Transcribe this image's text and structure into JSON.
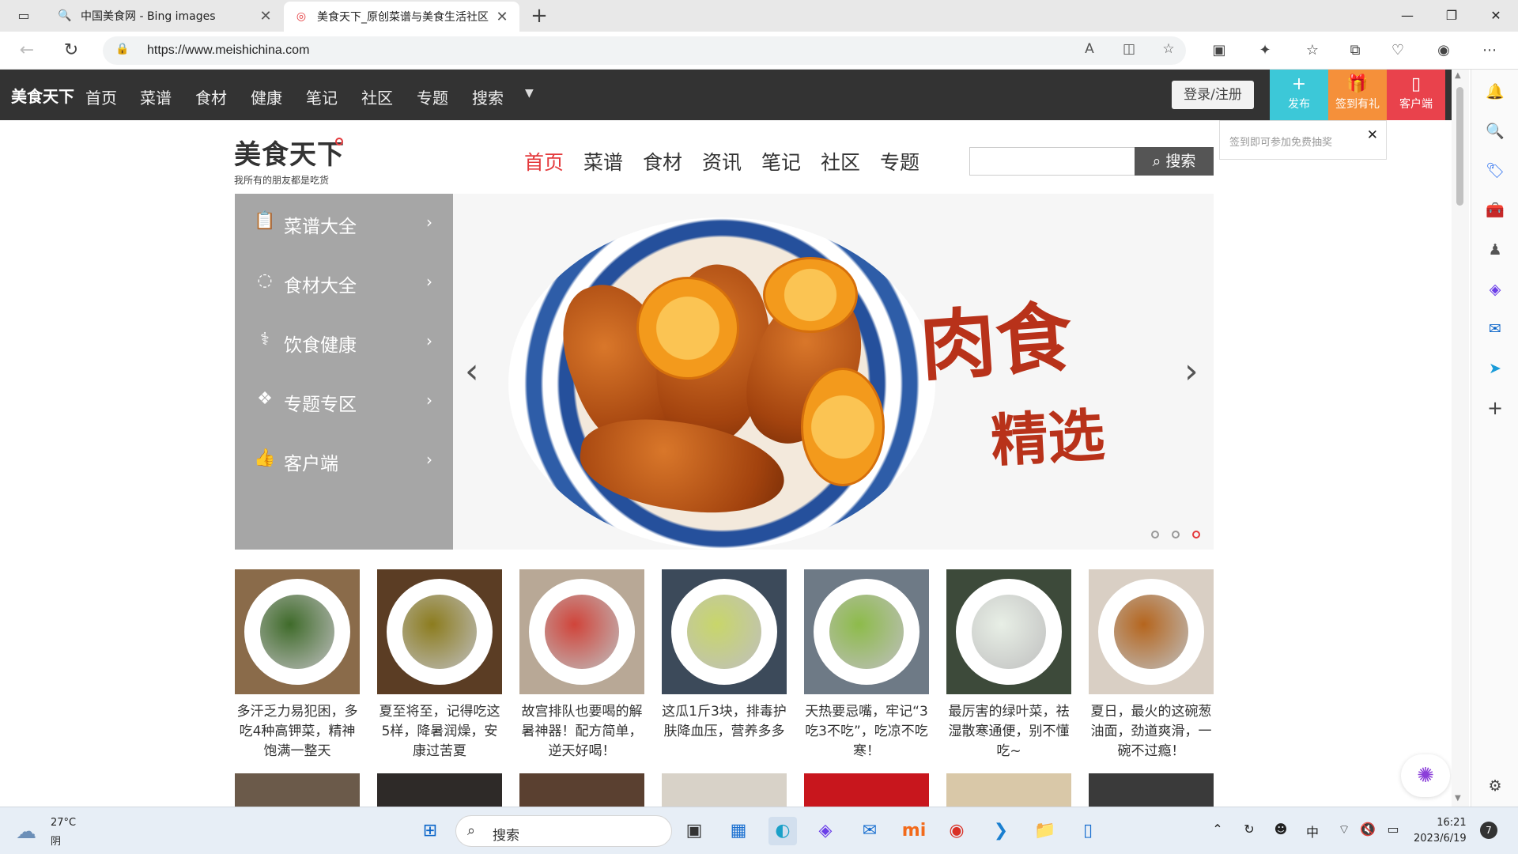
{
  "browser": {
    "tabs": [
      {
        "title": "中国美食网 - Bing images",
        "favicon": "bing-search-icon"
      },
      {
        "title": "美食天下_原创菜谱与美食生活社区",
        "favicon": "meishichina-icon"
      }
    ],
    "url": "https://www.meishichina.com"
  },
  "topbar": {
    "brand": "美食天下",
    "nav": [
      "首页",
      "菜谱",
      "食材",
      "健康",
      "笔记",
      "社区",
      "专题",
      "搜索"
    ],
    "login": "登录/注册",
    "actions": [
      {
        "label": "发布",
        "color": "#3cc8d8"
      },
      {
        "label": "签到有礼",
        "color": "#f5903a"
      },
      {
        "label": "客户端",
        "color": "#e9424c"
      }
    ],
    "signin_tip": "签到即可参加免费抽奖"
  },
  "header": {
    "logo": "美食天下",
    "slogan": "我所有的朋友都是吃货",
    "nav": [
      "首页",
      "菜谱",
      "食材",
      "资讯",
      "笔记",
      "社区",
      "专题"
    ],
    "search_button": "搜索"
  },
  "menu": [
    {
      "label": "菜谱大全",
      "icon": "clipboard-icon"
    },
    {
      "label": "食材大全",
      "icon": "tomato-icon"
    },
    {
      "label": "饮食健康",
      "icon": "pill-icon"
    },
    {
      "label": "专题专区",
      "icon": "diamond-grid-icon"
    },
    {
      "label": "客户端",
      "icon": "thumbs-up-icon"
    }
  ],
  "banner": {
    "title_line1": "肉食",
    "title_line2": "精选"
  },
  "recipes": [
    {
      "caption": "多汗乏力易犯困，多吃4种高钾菜，精神饱满一整天",
      "bg": "#8a6b4a",
      "food": "#3f6b2a"
    },
    {
      "caption": "夏至将至，记得吃这5样，降暑润燥，安康过苦夏",
      "bg": "#5b3d24",
      "food": "#8c7c1e"
    },
    {
      "caption": "故宫排队也要喝的解暑神器！配方简单，逆天好喝！",
      "bg": "#b8a896",
      "food": "#d0443a"
    },
    {
      "caption": "这瓜1斤3块，排毒护肤降血压，营养多多",
      "bg": "#3c4a5a",
      "food": "#c8d66a"
    },
    {
      "caption": "天热要忌嘴，牢记“3吃3不吃”，吃凉不吃寒！",
      "bg": "#6e7a86",
      "food": "#8dbb4a"
    },
    {
      "caption": "最厉害的绿叶菜，祛湿散寒通便，别不懂吃~",
      "bg": "#3d4a3a",
      "food": "#e8efe6"
    },
    {
      "caption": "夏日，最火的这碗葱油面，劲道爽滑，一碗不过瘾！",
      "bg": "#d9cfc4",
      "food": "#b5651d"
    }
  ],
  "taskbar": {
    "temperature": "27°C",
    "condition": "阴",
    "search": "搜索",
    "ime": "中",
    "time": "16:21",
    "date": "2023/6/19",
    "notifications": "7"
  }
}
